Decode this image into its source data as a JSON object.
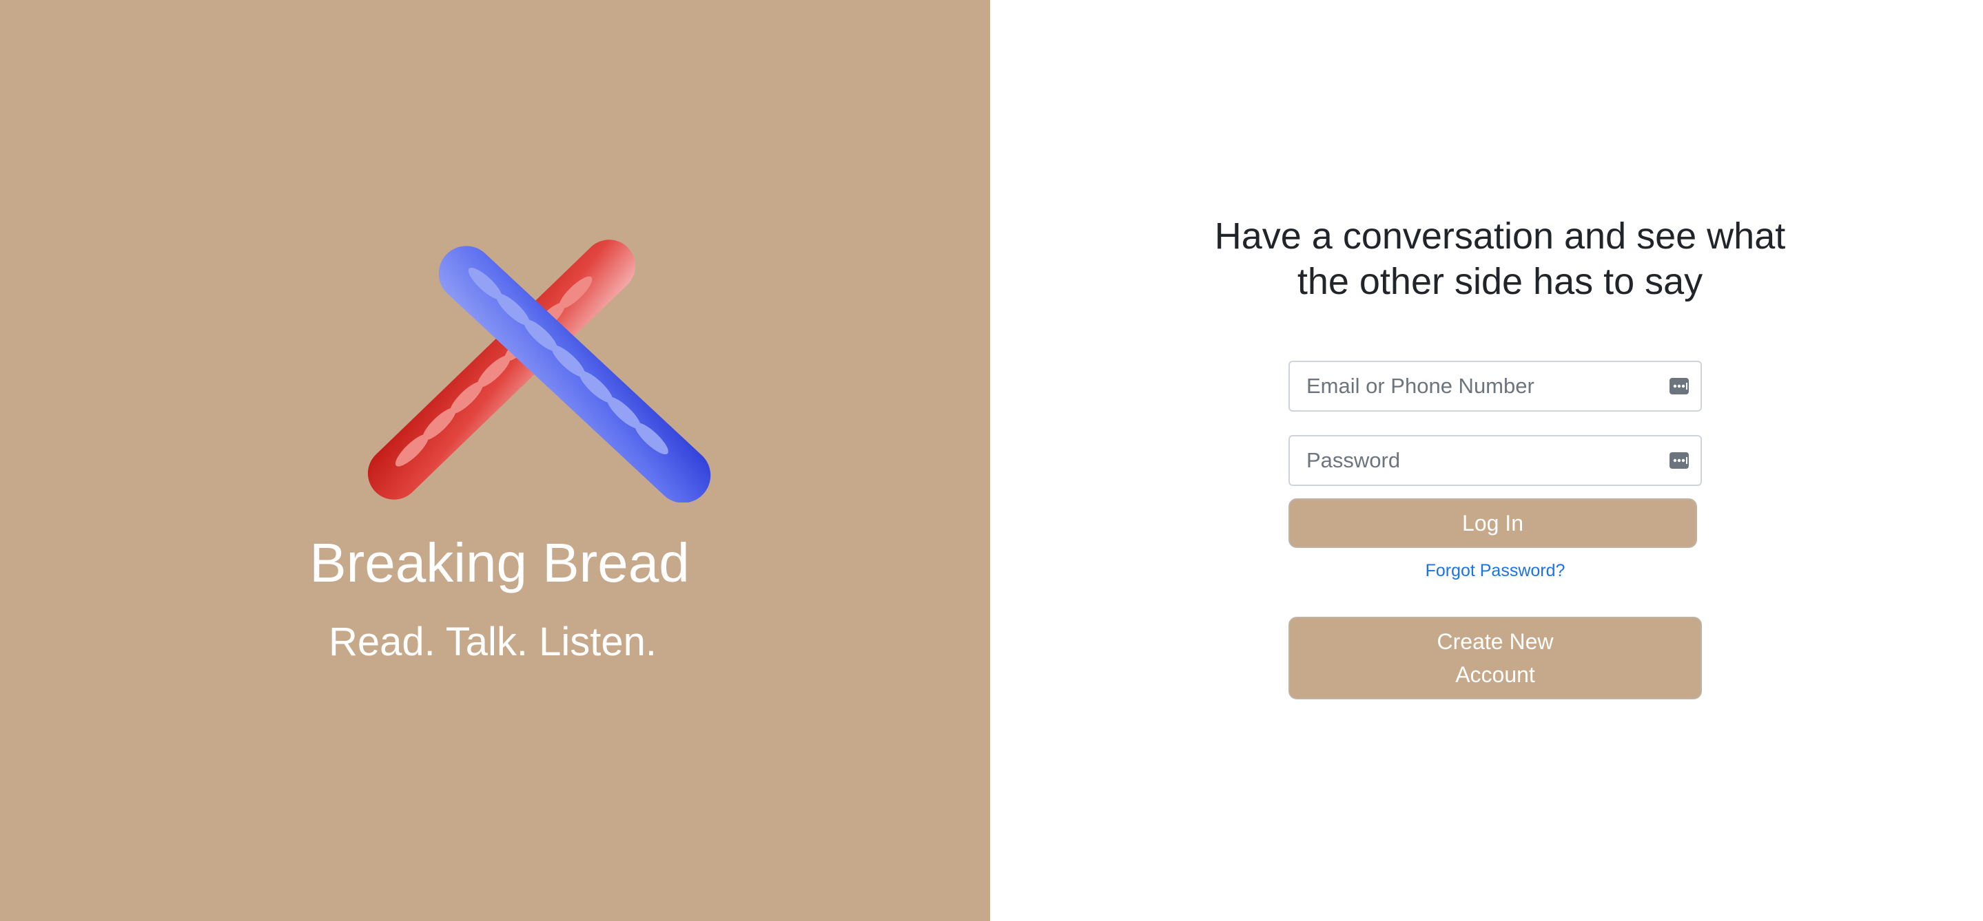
{
  "brand": {
    "title": "Breaking Bread",
    "tagline": "Read. Talk. Listen.",
    "logo_icon": "crossed-baguettes-logo",
    "left_color": "#c6a98b",
    "red_bread_color": "#d9302b",
    "blue_bread_color": "#4a5ee8"
  },
  "login": {
    "headline": "Have a conversation and see what the other side has to say",
    "email_placeholder": "Email or Phone Number",
    "email_value": "",
    "password_placeholder": "Password",
    "password_value": "",
    "autofill_icon": "password-autofill-icon",
    "login_label": "Log In",
    "forgot_label": "Forgot Password?",
    "create_label": "Create New Account",
    "button_color": "#c6a98b",
    "link_color": "#1a73e8"
  }
}
